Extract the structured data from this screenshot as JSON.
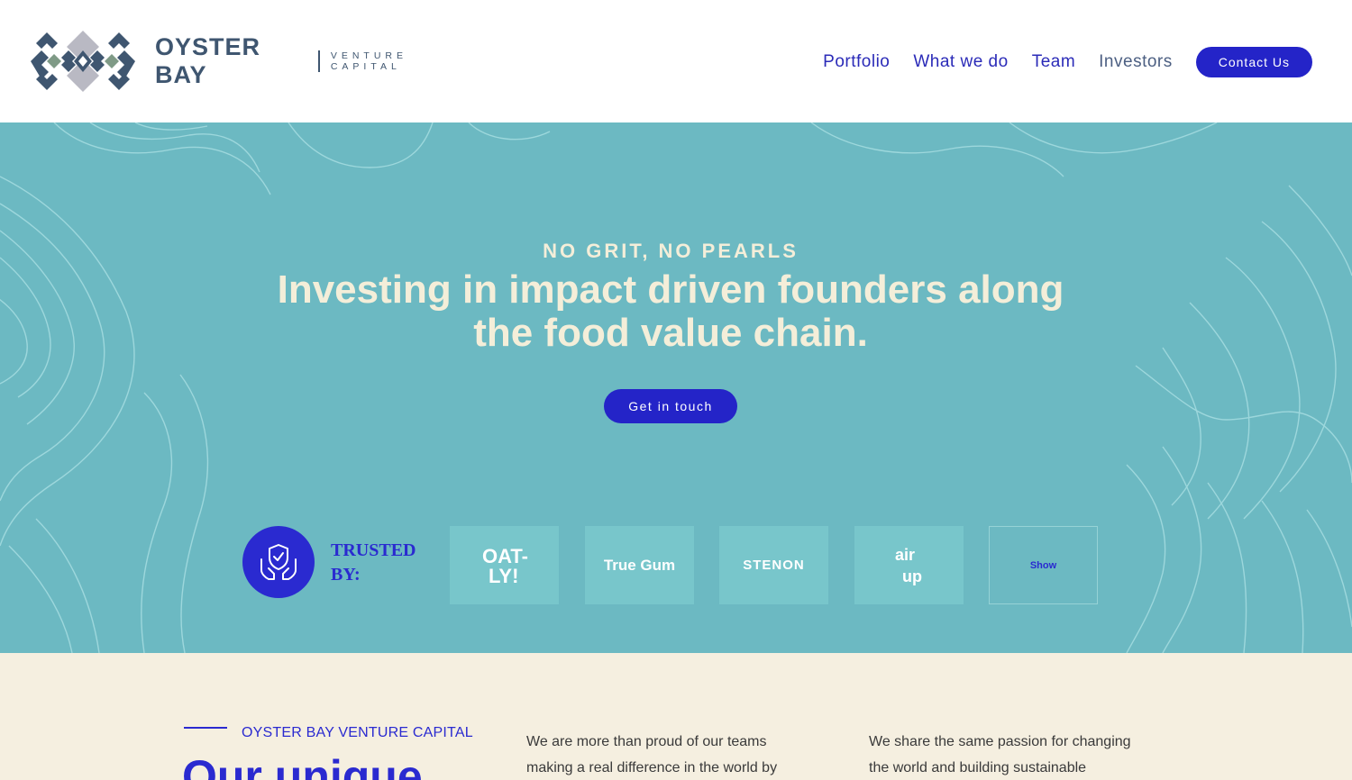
{
  "brand": {
    "name": "OYSTER BAY",
    "sub_line1": "VENTURE",
    "sub_line2": "CAPITAL",
    "colors": {
      "slate": "#3f5670",
      "grey": "#b9b9c3",
      "green": "#7f9a86"
    }
  },
  "nav": {
    "items": [
      {
        "label": "Portfolio"
      },
      {
        "label": "What we do"
      },
      {
        "label": "Team"
      },
      {
        "label": "Investors"
      }
    ],
    "contact_label": "Contact Us"
  },
  "hero": {
    "eyebrow": "NO GRIT, NO PEARLS",
    "headline_line1": "Investing in impact driven founders along",
    "headline_line2": "the food value chain.",
    "cta_label": "Get in touch",
    "background_color": "#6cb9c2",
    "accent_color": "#2424c8",
    "text_color": "#f4eed9"
  },
  "trusted": {
    "icon": "hands-shield-check-icon",
    "label_line1": "TRUSTED",
    "label_line2": "BY:",
    "logos": [
      {
        "name": "oatly-logo",
        "text": "OAT-LY!"
      },
      {
        "name": "truegum-logo",
        "text": "True Gum"
      },
      {
        "name": "stenon-logo",
        "text": "STENON"
      },
      {
        "name": "airup-logo",
        "text": "air up"
      }
    ],
    "show_label": "Show"
  },
  "about": {
    "eyebrow": "OYSTER BAY VENTURE CAPITAL",
    "heading": "Our unique",
    "col1_line1": "We are more than proud of our teams",
    "col1_line2": "making a real difference in the world by",
    "col2_line1": "We share the same passion for changing",
    "col2_line2": "the world and building sustainable"
  }
}
